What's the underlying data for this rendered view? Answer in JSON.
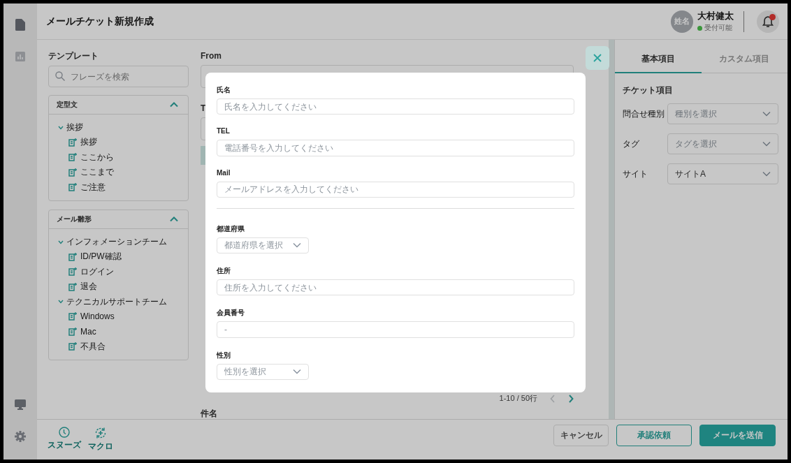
{
  "rail": {
    "items": [
      {
        "kind": "document",
        "selected": true
      },
      {
        "kind": "chart",
        "selected": false
      }
    ],
    "bottom_items": [
      {
        "kind": "monitor"
      },
      {
        "kind": "settings"
      }
    ]
  },
  "header": {
    "title": "メールチケット新規作成",
    "user": {
      "avatar_text": "姓名",
      "name": "大村健太",
      "status": "受付可能"
    },
    "notification": {
      "unread": true
    }
  },
  "template_panel": {
    "title": "テンプレート",
    "search": {
      "placeholder": "フレーズを検索"
    },
    "sections": [
      {
        "title": "定型文",
        "expanded": true,
        "groups": [
          {
            "label": "挨拶",
            "expanded": true,
            "children": [
              {
                "label": "挨拶"
              },
              {
                "label": "ここから"
              },
              {
                "label": "ここまで"
              },
              {
                "label": "ご注意"
              }
            ]
          }
        ]
      },
      {
        "title": "メール雛形",
        "expanded": true,
        "groups": [
          {
            "label": "インフォメーションチーム",
            "expanded": true,
            "children": [
              {
                "label": "ID/PW確認"
              },
              {
                "label": "ログイン"
              },
              {
                "label": "退会"
              }
            ]
          },
          {
            "label": "テクニカルサポートチーム",
            "expanded": true,
            "children": [
              {
                "label": "Windows"
              },
              {
                "label": "Mac"
              },
              {
                "label": "不具合"
              }
            ]
          }
        ]
      }
    ]
  },
  "compose": {
    "from_label": "From",
    "to_label": "T",
    "pagination": {
      "text": "1-10 / 50行",
      "prev_disabled": true,
      "next_disabled": false
    },
    "subject_label": "件名"
  },
  "modal": {
    "fields": [
      {
        "kind": "text",
        "label": "氏名",
        "placeholder": "氏名を入力してください"
      },
      {
        "kind": "text",
        "label": "TEL",
        "placeholder": "電話番号を入力してください"
      },
      {
        "kind": "text",
        "label": "Mail",
        "placeholder": "メールアドレスを入力してください"
      },
      {
        "kind": "divider"
      },
      {
        "kind": "select",
        "label": "都道府県",
        "placeholder": "都道府県を選択"
      },
      {
        "kind": "text",
        "label": "住所",
        "placeholder": "住所を入力してください"
      },
      {
        "kind": "text",
        "label": "会員番号",
        "placeholder": "-"
      },
      {
        "kind": "select",
        "label": "性別",
        "placeholder": "性別を選択"
      }
    ]
  },
  "right_panel": {
    "tabs": [
      {
        "label": "基本項目",
        "selected": true
      },
      {
        "label": "カスタム項目",
        "selected": false
      }
    ],
    "section_title": "チケット項目",
    "fields": [
      {
        "label": "問合せ種別",
        "placeholder": "種別を選択"
      },
      {
        "label": "タグ",
        "placeholder": "タグを選択"
      },
      {
        "label": "サイト",
        "value": "サイトA"
      }
    ]
  },
  "footer": {
    "tools": [
      {
        "kind": "snooze",
        "label": "スヌーズ"
      },
      {
        "kind": "macro",
        "label": "マクロ"
      }
    ],
    "buttons": [
      {
        "kind": "secondary",
        "label": "キャンセル"
      },
      {
        "kind": "outline",
        "label": "承認依頼"
      },
      {
        "kind": "primary",
        "label": "メールを送信"
      }
    ]
  }
}
